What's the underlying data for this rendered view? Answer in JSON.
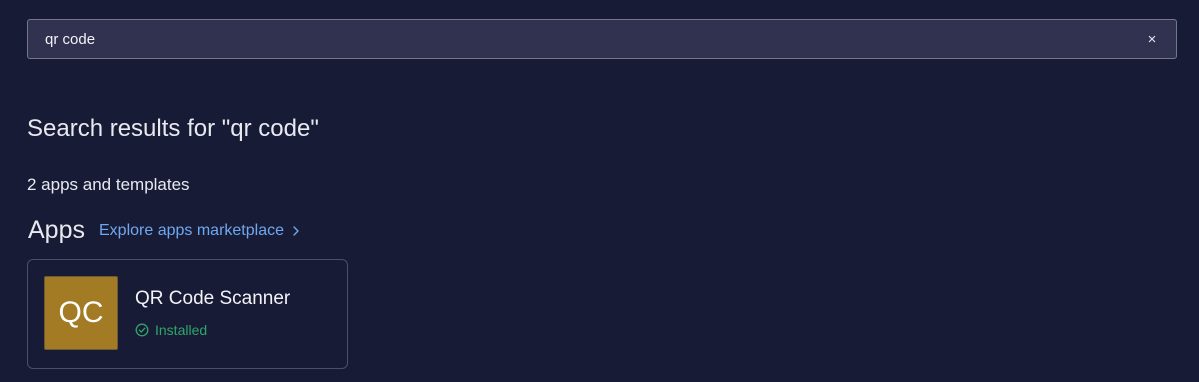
{
  "search": {
    "value": "qr code",
    "clear_icon": "close-icon",
    "clear_glyph": "×"
  },
  "results": {
    "title": "Search results for \"qr code\"",
    "count": "2 apps and templates"
  },
  "apps_section": {
    "heading": "Apps",
    "explore_link": "Explore apps marketplace",
    "explore_icon": "chevron-right-icon"
  },
  "apps": [
    {
      "logo_text": "QC",
      "name": "QR Code Scanner",
      "status": "Installed",
      "status_icon": "check-circle-icon"
    }
  ],
  "colors": {
    "background": "#181b35",
    "search_background": "#313150",
    "link": "#6fa8ef",
    "installed": "#2ea66b",
    "app_logo": "#a27b24"
  }
}
